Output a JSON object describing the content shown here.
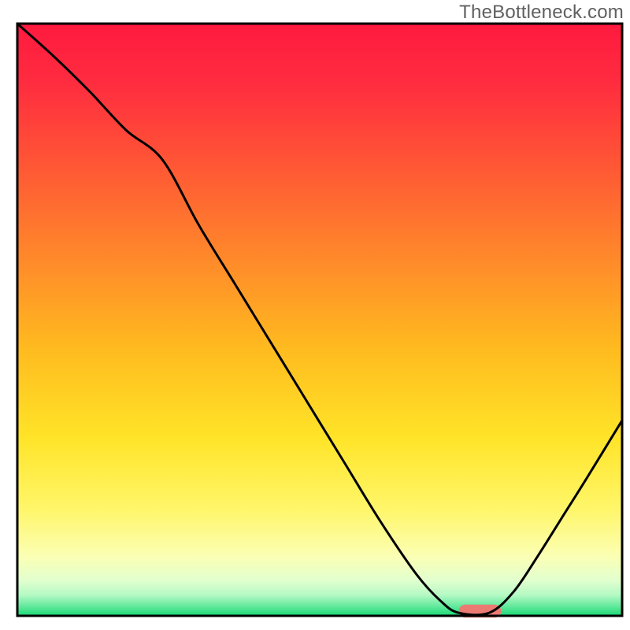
{
  "watermark": "TheBottleneck.com",
  "chart_data": {
    "type": "line",
    "title": "",
    "xlabel": "",
    "ylabel": "",
    "xlim": [
      0,
      100
    ],
    "ylim": [
      0,
      100
    ],
    "background": {
      "type": "vertical-gradient",
      "stops": [
        {
          "offset": 0.0,
          "color": "#ff1a3f"
        },
        {
          "offset": 0.1,
          "color": "#ff2c3f"
        },
        {
          "offset": 0.25,
          "color": "#ff5a34"
        },
        {
          "offset": 0.4,
          "color": "#ff8a2a"
        },
        {
          "offset": 0.55,
          "color": "#ffbb1f"
        },
        {
          "offset": 0.7,
          "color": "#ffe428"
        },
        {
          "offset": 0.82,
          "color": "#fff66a"
        },
        {
          "offset": 0.9,
          "color": "#fbffb4"
        },
        {
          "offset": 0.94,
          "color": "#e2ffcf"
        },
        {
          "offset": 0.965,
          "color": "#b4f9c4"
        },
        {
          "offset": 0.985,
          "color": "#5ee89a"
        },
        {
          "offset": 1.0,
          "color": "#18d874"
        }
      ]
    },
    "series": [
      {
        "name": "bottleneck-curve",
        "stroke": "#000000",
        "stroke_width": 3,
        "x": [
          0.0,
          6.0,
          12.0,
          18.0,
          24.0,
          30.0,
          36.0,
          42.0,
          48.0,
          54.0,
          60.0,
          66.0,
          70.0,
          73.0,
          78.0,
          82.0,
          86.0,
          90.0,
          94.0,
          100.0
        ],
        "y": [
          100.0,
          94.5,
          88.5,
          82.0,
          77.0,
          66.0,
          56.0,
          46.0,
          36.0,
          26.0,
          16.0,
          7.0,
          2.5,
          0.5,
          0.5,
          4.0,
          10.0,
          16.5,
          23.0,
          33.0
        ]
      }
    ],
    "marks": [
      {
        "name": "optimal-marker",
        "type": "rounded-bar",
        "color": "#eb7a73",
        "x_center": 76.5,
        "y": 0.8,
        "width": 7.0,
        "height": 2.2
      }
    ],
    "frame": {
      "stroke": "#000000",
      "stroke_width": 3
    }
  }
}
